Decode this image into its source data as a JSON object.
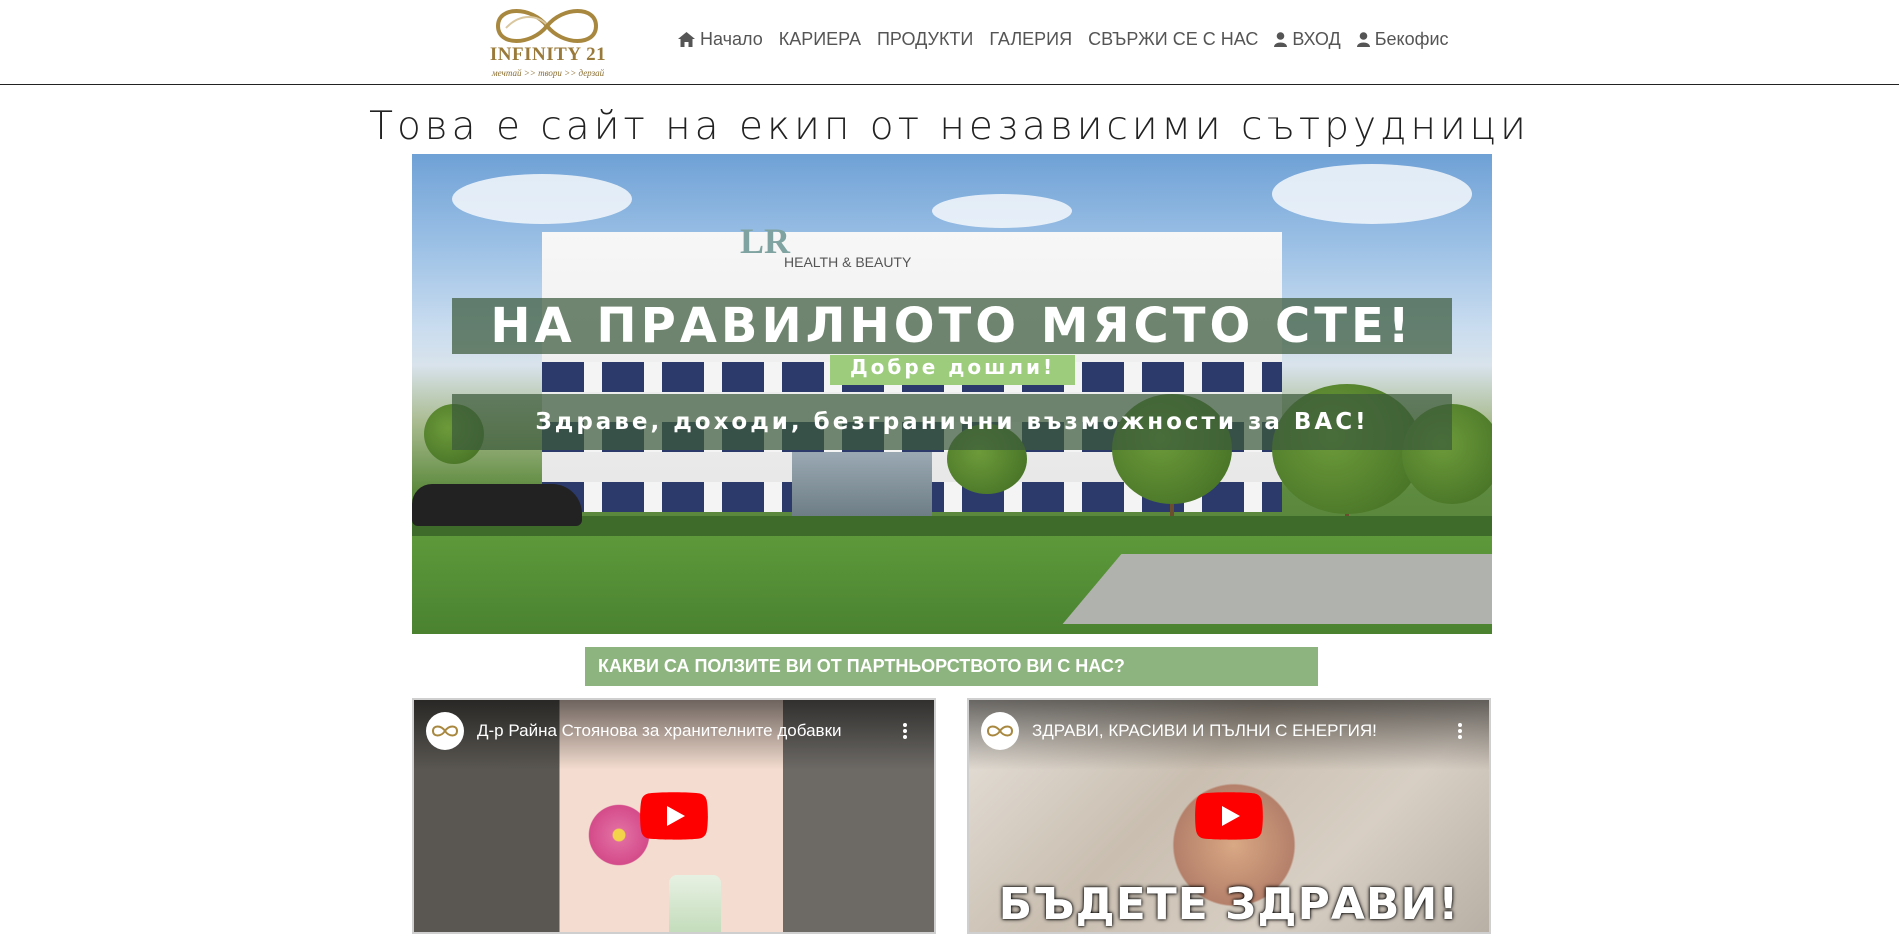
{
  "brand": {
    "name": "INFINITY 21",
    "tagline": "мечтай >> твори >> дерзай"
  },
  "nav": {
    "items": [
      {
        "label": "Начало",
        "icon": "home-icon"
      },
      {
        "label": "КАРИЕРА",
        "icon": ""
      },
      {
        "label": "ПРОДУКТИ",
        "icon": ""
      },
      {
        "label": "ГАЛЕРИЯ",
        "icon": ""
      },
      {
        "label": "СВЪРЖИ СЕ С НАС",
        "icon": ""
      },
      {
        "label": "ВХОД",
        "icon": "user-icon"
      },
      {
        "label": "Бекофис",
        "icon": "user-icon"
      }
    ]
  },
  "page": {
    "title": "Това е сайт на екип от независими сътрудници"
  },
  "hero": {
    "sign_logo": "LR",
    "sign_text": "HEALTH & BEAUTY",
    "headline": "НА ПРАВИЛНОТО МЯСТО СТЕ!",
    "welcome": "Добре дошли!",
    "subline": "Здраве, доходи, безгранични възможности за ВАС!"
  },
  "cta": {
    "label": "КАКВИ СА ПОЛЗИТЕ ВИ ОТ ПАРТНЬОРСТВОТО ВИ С НАС?"
  },
  "videos": [
    {
      "title": "Д-р Райна Стоянова за хранителните добавки",
      "caption": ""
    },
    {
      "title": "ЗДРАВИ, КРАСИВИ И ПЪЛНИ С ЕНЕРГИЯ!",
      "caption": "БЪДЕТЕ ЗДРАВИ!"
    }
  ],
  "colors": {
    "accent_green": "#8db47e",
    "welcome_green": "#9ccc7c",
    "logo_gold": "#9a7a3a",
    "youtube_red": "#ff0000"
  }
}
